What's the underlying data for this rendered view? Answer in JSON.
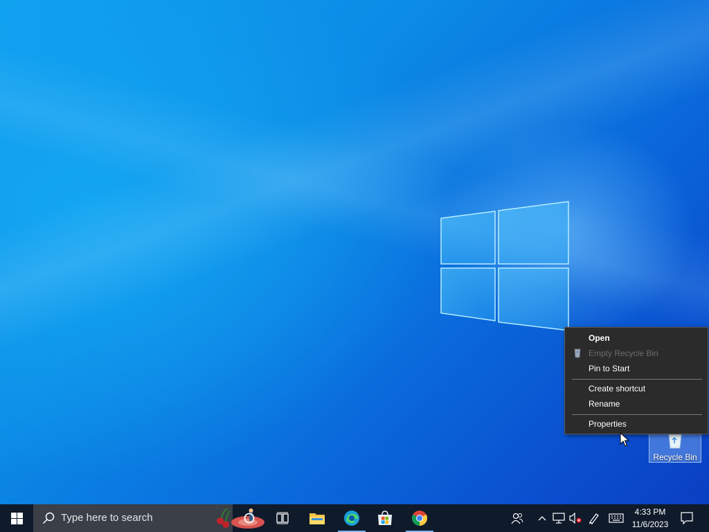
{
  "desktop": {
    "recycle_bin_label": "Recycle Bin"
  },
  "context_menu": {
    "items": [
      {
        "label": "Open",
        "bold": true,
        "enabled": true
      },
      {
        "label": "Empty Recycle Bin",
        "bold": false,
        "enabled": false,
        "icon": "recycle-bin-icon"
      },
      {
        "label": "Pin to Start",
        "bold": false,
        "enabled": true
      },
      {
        "label": "Create shortcut",
        "bold": false,
        "enabled": true
      },
      {
        "label": "Rename",
        "bold": false,
        "enabled": true
      },
      {
        "label": "Properties",
        "bold": false,
        "enabled": true
      }
    ]
  },
  "taskbar": {
    "search_placeholder": "Type here to search",
    "pinned_apps": [
      "cortana-icon",
      "task-view-icon",
      "file-explorer-icon",
      "edge-icon",
      "microsoft-store-icon",
      "chrome-icon"
    ],
    "tray_icons": [
      "people-icon",
      "chevron-up-icon",
      "network-icon",
      "volume-muted-icon",
      "pen-icon",
      "keyboard-icon",
      "notifications-icon"
    ],
    "clock_time": "4:33 PM",
    "clock_date": "11/6/2023"
  },
  "colors": {
    "taskbar_bg": "#0f1a2b",
    "menu_bg": "#2b2b2b",
    "accent": "#0a6fdd"
  }
}
